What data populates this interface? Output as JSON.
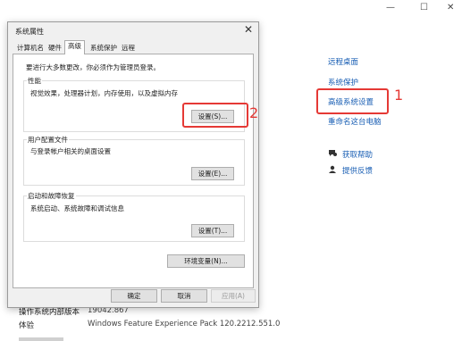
{
  "window_controls": {
    "minimize": "—",
    "maximize": "☐",
    "close": "✕"
  },
  "sidebar_links": [
    "远程桌面",
    "系统保护",
    "高级系统设置",
    "重命名这台电脑"
  ],
  "help_links": [
    {
      "icon": "help-chat-icon",
      "label": "获取帮助"
    },
    {
      "icon": "feedback-icon",
      "label": "提供反馈"
    }
  ],
  "annotations": {
    "marker_1": "1",
    "marker_2": "2"
  },
  "system_info": {
    "os_build_label": "操作系统内部版本",
    "os_build_value": "19042.867",
    "experience_label": "体验",
    "experience_value": "Windows Feature Experience Pack 120.2212.551.0"
  },
  "dialog": {
    "title": "系统属性",
    "close": "✕",
    "tabs": [
      "计算机名",
      "硬件",
      "高级",
      "系统保护",
      "远程"
    ],
    "active_tab": "高级",
    "admin_note": "要进行大多数更改，你必须作为管理员登录。",
    "performance": {
      "title": "性能",
      "desc": "视觉效果，处理器计划，内存使用，以及虚拟内存",
      "button": "设置(S)..."
    },
    "user_profiles": {
      "title": "用户配置文件",
      "desc": "与登录帐户相关的桌面设置",
      "button": "设置(E)..."
    },
    "startup_recovery": {
      "title": "启动和故障恢复",
      "desc": "系统启动、系统故障和调试信息",
      "button": "设置(T)..."
    },
    "env_button": "环境变量(N)...",
    "footer": {
      "ok": "确定",
      "cancel": "取消",
      "apply": "应用(A)"
    }
  }
}
